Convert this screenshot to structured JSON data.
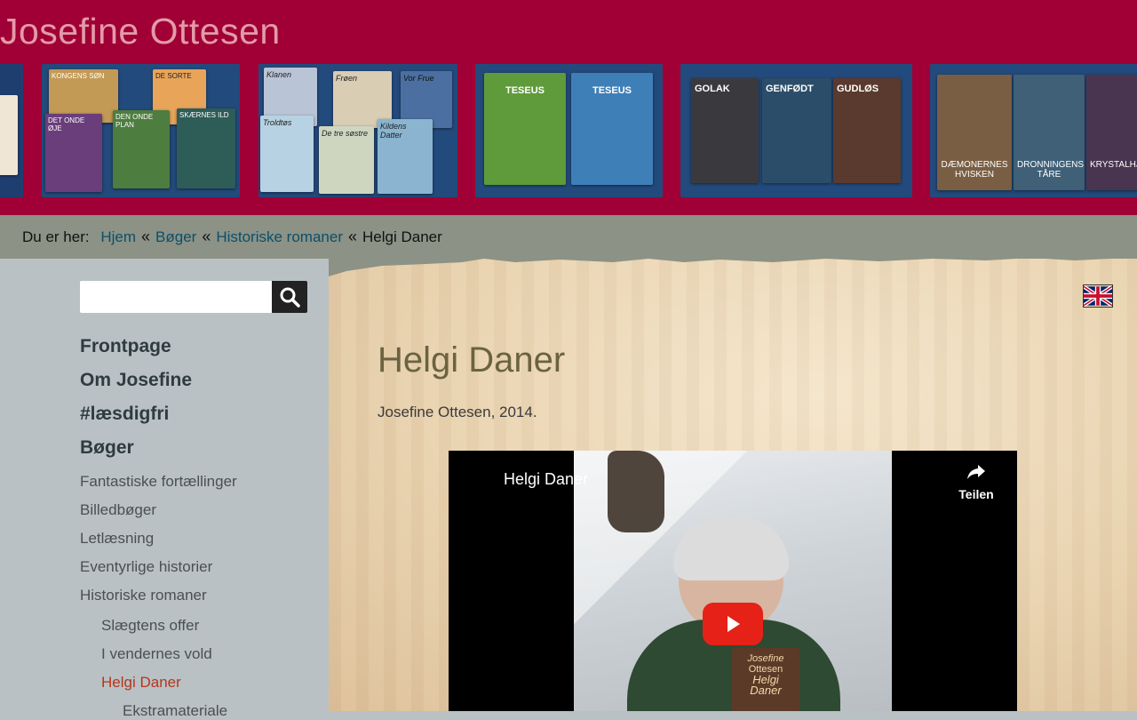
{
  "site": {
    "title": "Josefine Ottesen"
  },
  "breadcrumb": {
    "label": "Du er her:",
    "separator": "«",
    "items": [
      "Hjem",
      "Bøger",
      "Historiske romaner"
    ],
    "current": "Helgi Daner"
  },
  "search": {
    "placeholder": "",
    "icon": "search-icon"
  },
  "nav": {
    "main": [
      "Frontpage",
      "Om Josefine",
      "#læsdigfri",
      "Bøger"
    ],
    "books_sub": [
      "Fantastiske fortællinger",
      "Billedbøger",
      "Letlæsning",
      "Eventyrlige historier",
      "Historiske romaner"
    ],
    "historical_sub": [
      "Slægtens offer",
      "I vendernes vold",
      "Helgi Daner"
    ],
    "helgi_sub": [
      "Ekstramateriale"
    ]
  },
  "content": {
    "language_flag": "uk-flag-icon",
    "title": "Helgi Daner",
    "byline": "Josefine Ottesen, 2014."
  },
  "video": {
    "title": "Helgi Daner",
    "share_label": "Teilen",
    "play_icon": "play-icon",
    "book_cover": {
      "line1": "Josefine",
      "line2": "Ottesen",
      "line3": "Helgi",
      "line4": "Daner"
    }
  },
  "banner": {
    "covers": [
      {
        "group": 1,
        "titles": [
          "Kongens Søn",
          "De Sorte",
          "Det Onde Øje",
          "Den Onde Plan",
          "Skærnes Ild"
        ]
      },
      {
        "group": 2,
        "titles": [
          "Klanen",
          "Frøen",
          "Vor Frue",
          "Troldtøs",
          "De tre søstre",
          "Kildens Datter"
        ]
      },
      {
        "group": 3,
        "titles": [
          "Teseus",
          "Teseus"
        ]
      },
      {
        "group": 4,
        "titles": [
          "Golak",
          "Genfødt",
          "Gudløs"
        ]
      },
      {
        "group": 5,
        "titles": [
          "Dæmonernes Hvisken",
          "Dronningens Tåre",
          "Krystalhjertet"
        ]
      }
    ]
  },
  "colors": {
    "header": "#a00035",
    "breadcrumb_bg": "#8c9285",
    "sidebar_bg": "#b9c1c4",
    "link": "#0b4f6b",
    "active": "#b7351e"
  }
}
